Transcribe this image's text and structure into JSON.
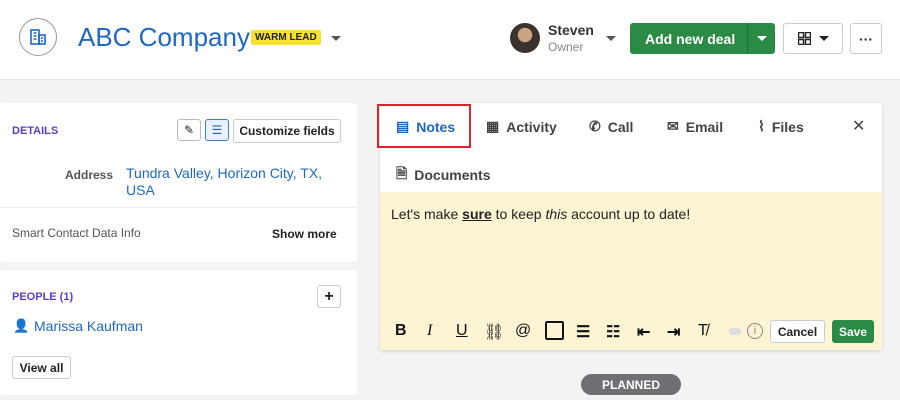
{
  "header": {
    "company": "ABC Company",
    "badge": "WARM LEAD",
    "owner_name": "Steven",
    "owner_role": "Owner",
    "add_deal": "Add new deal",
    "more": "···"
  },
  "details": {
    "title": "DETAILS",
    "customize": "Customize fields",
    "address_label": "Address",
    "address_value": "Tundra Valley, Horizon City, TX, USA",
    "smart_label": "Smart Contact Data Info",
    "show_more": "Show more"
  },
  "people": {
    "title": "PEOPLE (1)",
    "add": "+",
    "person": "Marissa Kaufman",
    "view_all": "View all"
  },
  "tabs": [
    {
      "label": "Notes"
    },
    {
      "label": "Activity"
    },
    {
      "label": "Call"
    },
    {
      "label": "Email"
    },
    {
      "label": "Files"
    },
    {
      "label": "Documents"
    }
  ],
  "editor": {
    "before": "Let's make ",
    "bold": "sure",
    "middle": " to keep ",
    "italic": "this",
    "after": " account up to date!",
    "cancel": "Cancel",
    "save": "Save"
  },
  "status": "PLANNED",
  "colors": {
    "accent": "#1f68c1",
    "green": "#2a8a46",
    "highlight": "#d9262b"
  }
}
